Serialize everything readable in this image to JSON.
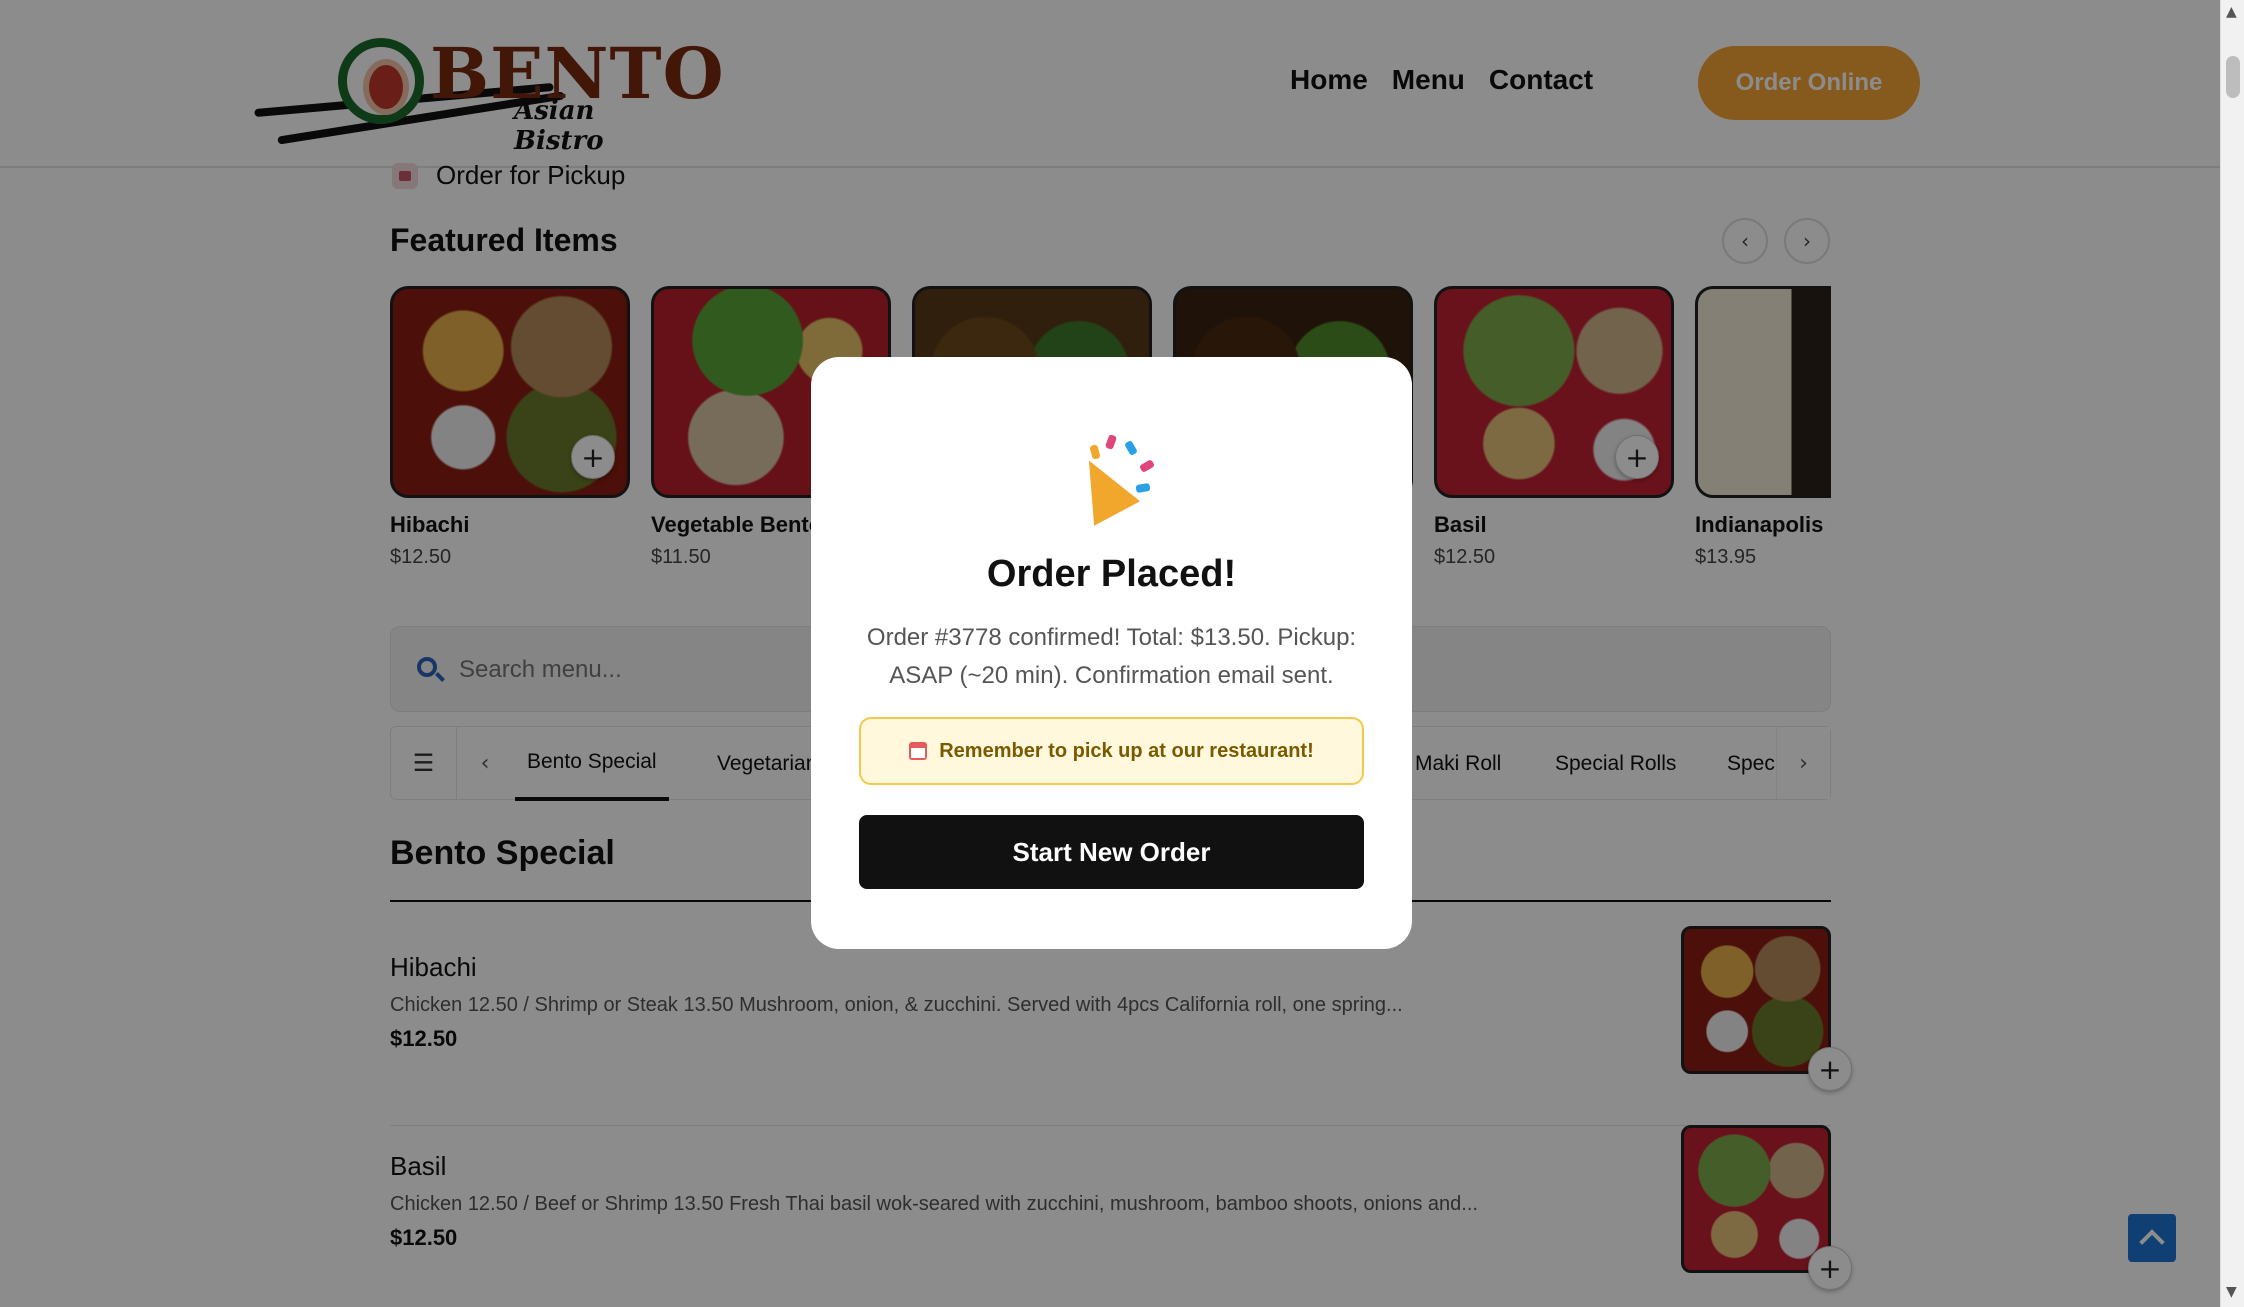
{
  "brand": {
    "name": "BENTO",
    "tagline": "Asian Bistro"
  },
  "nav": {
    "items": [
      "Home",
      "Menu",
      "Contact"
    ],
    "order_online": "Order Online"
  },
  "pickup": {
    "label": "Order for Pickup"
  },
  "featured": {
    "title": "Featured Items",
    "prev": "‹",
    "next": "›",
    "items": [
      {
        "name": "Hibachi",
        "price": "$12.50"
      },
      {
        "name": "Vegetable Bento",
        "price": "$11.50"
      },
      {
        "name": "",
        "price": ""
      },
      {
        "name": "",
        "price": ""
      },
      {
        "name": "Basil",
        "price": "$12.50"
      },
      {
        "name": "Indianapolis Roll",
        "price": "$13.95"
      }
    ]
  },
  "search": {
    "placeholder": "Search menu..."
  },
  "categories": {
    "menu_icon": "☰",
    "prev": "‹",
    "next": "›",
    "tabs": [
      "Bento Special",
      "Vegetarian",
      "Maki Roll",
      "Special Rolls",
      "Special"
    ]
  },
  "section": {
    "title": "Bento Special",
    "items": [
      {
        "name": "Hibachi",
        "description": "Chicken 12.50 / Shrimp or Steak 13.50 Mushroom, onion, & zucchini. Served with 4pcs California roll, one spring...",
        "price": "$12.50"
      },
      {
        "name": "Basil",
        "description": "Chicken 12.50 / Beef or Shrimp 13.50 Fresh Thai basil wok-seared with zucchini, mushroom, bamboo shoots, onions and...",
        "price": "$12.50"
      }
    ]
  },
  "modal": {
    "icon": "party-popper-icon",
    "title": "Order Placed!",
    "message": "Order #3778 confirmed! Total: $13.50. Pickup: ASAP (~20 min). Confirmation email sent.",
    "reminder": "Remember to pick up at our restaurant!",
    "button": "Start New Order"
  },
  "colors": {
    "accent": "#f4a234",
    "scroll_top": "#1e73d2",
    "reminder_border": "#f2c94c"
  }
}
